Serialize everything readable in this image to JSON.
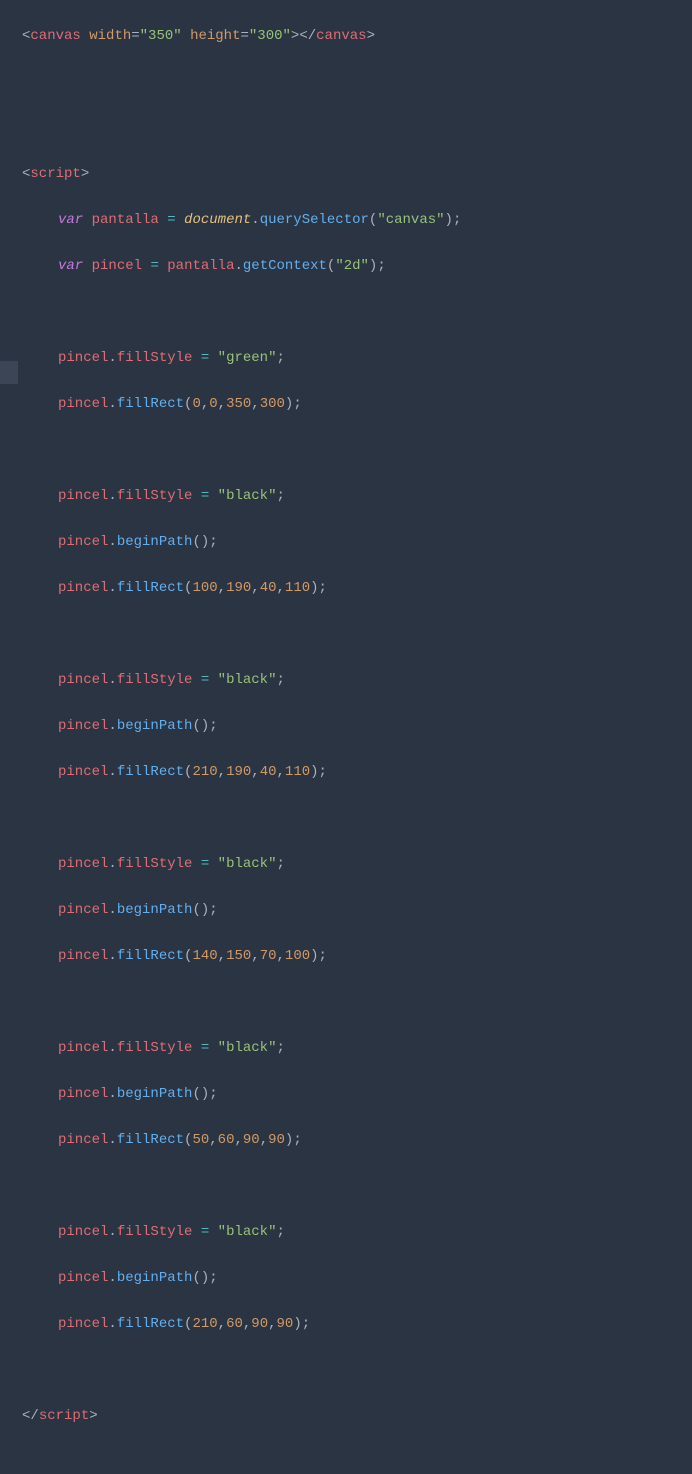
{
  "code": {
    "canvas_open": "<",
    "canvas_tag": "canvas",
    "width_attr": "width",
    "height_attr": "height",
    "eq": "=",
    "width_val": "\"350\"",
    "height_val": "\"300\"",
    "close_open": "></",
    "gt": ">",
    "script_tag": "script",
    "var_kw": "var",
    "pantalla": "pantalla",
    "pincel": "pincel",
    "document": "document",
    "querySelector": "querySelector",
    "canvas_str": "\"canvas\"",
    "getContext": "getContext",
    "ctx2d": "\"2d\"",
    "fillStyle": "fillStyle",
    "green": "\"green\"",
    "black": "\"black\"",
    "fillRect": "fillRect",
    "beginPath": "beginPath",
    "dot": ".",
    "assign": " = ",
    "semi": ";",
    "op_paren": "(",
    "cl_paren": ")",
    "comma": ",",
    "sp": " ",
    "lt_slash": "</",
    "n0": "0",
    "n350": "350",
    "n300": "300",
    "n100": "100",
    "n190": "190",
    "n40": "40",
    "n110": "110",
    "n210": "210",
    "n140": "140",
    "n150": "150",
    "n70": "70",
    "n50": "50",
    "n60": "60",
    "n90": "90"
  }
}
